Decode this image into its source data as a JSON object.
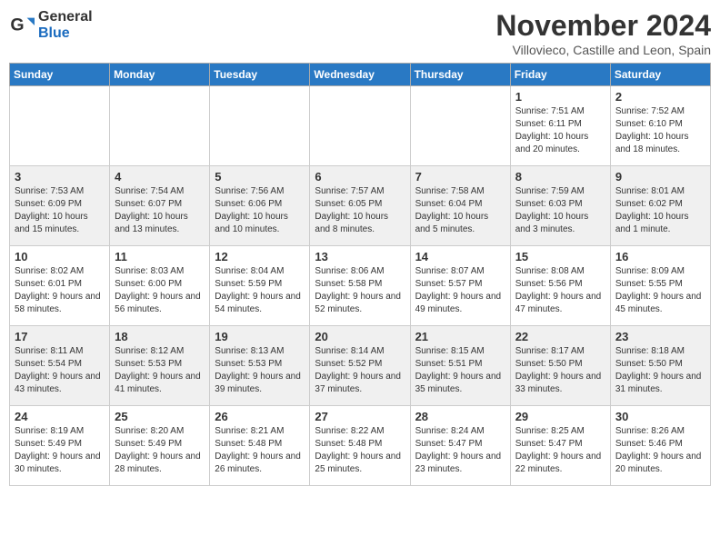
{
  "header": {
    "logo_general": "General",
    "logo_blue": "Blue",
    "month_title": "November 2024",
    "location": "Villovieco, Castille and Leon, Spain"
  },
  "weekdays": [
    "Sunday",
    "Monday",
    "Tuesday",
    "Wednesday",
    "Thursday",
    "Friday",
    "Saturday"
  ],
  "weeks": [
    [
      {
        "day": "",
        "info": ""
      },
      {
        "day": "",
        "info": ""
      },
      {
        "day": "",
        "info": ""
      },
      {
        "day": "",
        "info": ""
      },
      {
        "day": "",
        "info": ""
      },
      {
        "day": "1",
        "info": "Sunrise: 7:51 AM\nSunset: 6:11 PM\nDaylight: 10 hours and 20 minutes."
      },
      {
        "day": "2",
        "info": "Sunrise: 7:52 AM\nSunset: 6:10 PM\nDaylight: 10 hours and 18 minutes."
      }
    ],
    [
      {
        "day": "3",
        "info": "Sunrise: 7:53 AM\nSunset: 6:09 PM\nDaylight: 10 hours and 15 minutes."
      },
      {
        "day": "4",
        "info": "Sunrise: 7:54 AM\nSunset: 6:07 PM\nDaylight: 10 hours and 13 minutes."
      },
      {
        "day": "5",
        "info": "Sunrise: 7:56 AM\nSunset: 6:06 PM\nDaylight: 10 hours and 10 minutes."
      },
      {
        "day": "6",
        "info": "Sunrise: 7:57 AM\nSunset: 6:05 PM\nDaylight: 10 hours and 8 minutes."
      },
      {
        "day": "7",
        "info": "Sunrise: 7:58 AM\nSunset: 6:04 PM\nDaylight: 10 hours and 5 minutes."
      },
      {
        "day": "8",
        "info": "Sunrise: 7:59 AM\nSunset: 6:03 PM\nDaylight: 10 hours and 3 minutes."
      },
      {
        "day": "9",
        "info": "Sunrise: 8:01 AM\nSunset: 6:02 PM\nDaylight: 10 hours and 1 minute."
      }
    ],
    [
      {
        "day": "10",
        "info": "Sunrise: 8:02 AM\nSunset: 6:01 PM\nDaylight: 9 hours and 58 minutes."
      },
      {
        "day": "11",
        "info": "Sunrise: 8:03 AM\nSunset: 6:00 PM\nDaylight: 9 hours and 56 minutes."
      },
      {
        "day": "12",
        "info": "Sunrise: 8:04 AM\nSunset: 5:59 PM\nDaylight: 9 hours and 54 minutes."
      },
      {
        "day": "13",
        "info": "Sunrise: 8:06 AM\nSunset: 5:58 PM\nDaylight: 9 hours and 52 minutes."
      },
      {
        "day": "14",
        "info": "Sunrise: 8:07 AM\nSunset: 5:57 PM\nDaylight: 9 hours and 49 minutes."
      },
      {
        "day": "15",
        "info": "Sunrise: 8:08 AM\nSunset: 5:56 PM\nDaylight: 9 hours and 47 minutes."
      },
      {
        "day": "16",
        "info": "Sunrise: 8:09 AM\nSunset: 5:55 PM\nDaylight: 9 hours and 45 minutes."
      }
    ],
    [
      {
        "day": "17",
        "info": "Sunrise: 8:11 AM\nSunset: 5:54 PM\nDaylight: 9 hours and 43 minutes."
      },
      {
        "day": "18",
        "info": "Sunrise: 8:12 AM\nSunset: 5:53 PM\nDaylight: 9 hours and 41 minutes."
      },
      {
        "day": "19",
        "info": "Sunrise: 8:13 AM\nSunset: 5:53 PM\nDaylight: 9 hours and 39 minutes."
      },
      {
        "day": "20",
        "info": "Sunrise: 8:14 AM\nSunset: 5:52 PM\nDaylight: 9 hours and 37 minutes."
      },
      {
        "day": "21",
        "info": "Sunrise: 8:15 AM\nSunset: 5:51 PM\nDaylight: 9 hours and 35 minutes."
      },
      {
        "day": "22",
        "info": "Sunrise: 8:17 AM\nSunset: 5:50 PM\nDaylight: 9 hours and 33 minutes."
      },
      {
        "day": "23",
        "info": "Sunrise: 8:18 AM\nSunset: 5:50 PM\nDaylight: 9 hours and 31 minutes."
      }
    ],
    [
      {
        "day": "24",
        "info": "Sunrise: 8:19 AM\nSunset: 5:49 PM\nDaylight: 9 hours and 30 minutes."
      },
      {
        "day": "25",
        "info": "Sunrise: 8:20 AM\nSunset: 5:49 PM\nDaylight: 9 hours and 28 minutes."
      },
      {
        "day": "26",
        "info": "Sunrise: 8:21 AM\nSunset: 5:48 PM\nDaylight: 9 hours and 26 minutes."
      },
      {
        "day": "27",
        "info": "Sunrise: 8:22 AM\nSunset: 5:48 PM\nDaylight: 9 hours and 25 minutes."
      },
      {
        "day": "28",
        "info": "Sunrise: 8:24 AM\nSunset: 5:47 PM\nDaylight: 9 hours and 23 minutes."
      },
      {
        "day": "29",
        "info": "Sunrise: 8:25 AM\nSunset: 5:47 PM\nDaylight: 9 hours and 22 minutes."
      },
      {
        "day": "30",
        "info": "Sunrise: 8:26 AM\nSunset: 5:46 PM\nDaylight: 9 hours and 20 minutes."
      }
    ]
  ]
}
